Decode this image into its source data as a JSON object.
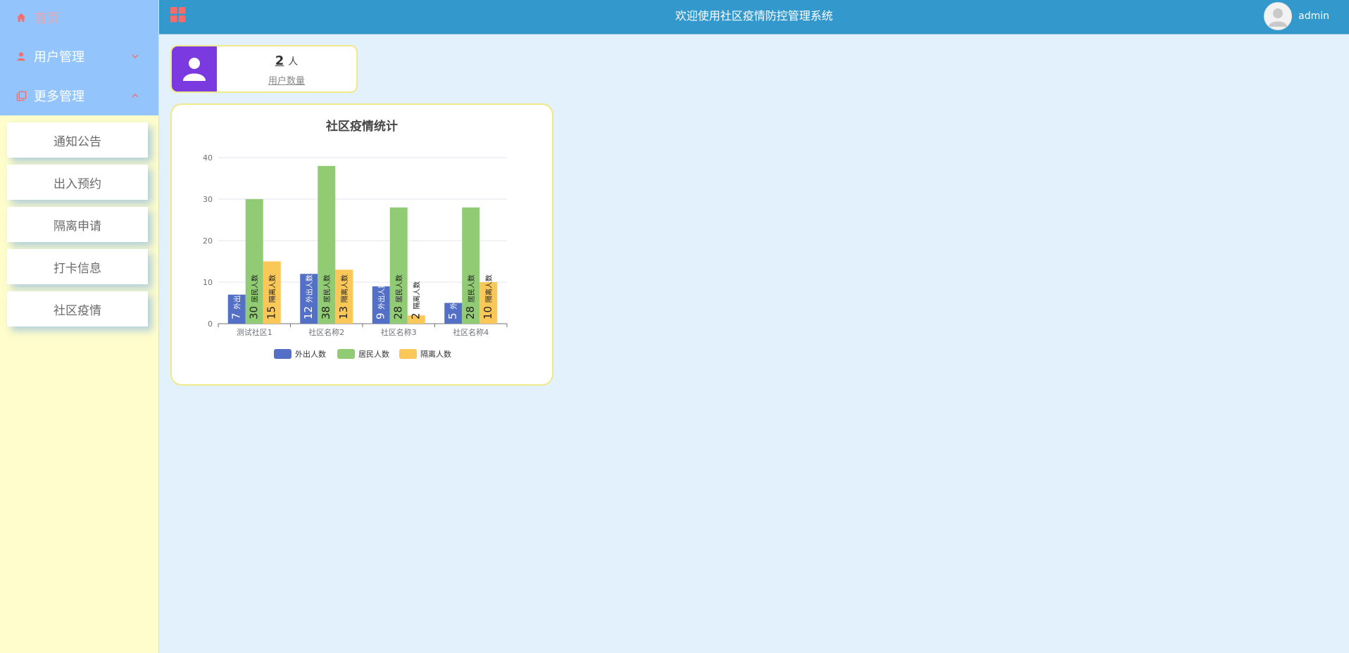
{
  "header": {
    "title": "欢迎使用社区疫情防控管理系统",
    "user": "admin",
    "bg_color": "#3399cc"
  },
  "sidebar": {
    "home": "首页",
    "items": [
      {
        "label": "用户管理",
        "icon": "user-icon",
        "expanded": false
      },
      {
        "label": "更多管理",
        "icon": "copy-icon",
        "expanded": true
      }
    ],
    "submenu": [
      "通知公告",
      "出入预约",
      "隔离申请",
      "打卡信息",
      "社区疫情"
    ]
  },
  "stat": {
    "value": "2",
    "unit": "人",
    "label": "用户数量",
    "icon": "user-icon"
  },
  "chart_data": {
    "type": "bar",
    "title": "社区疫情统计",
    "categories": [
      "测试社区1",
      "社区名称2",
      "社区名称3",
      "社区名称4"
    ],
    "series": [
      {
        "name": "外出人数",
        "values": [
          7,
          12,
          9,
          5
        ],
        "color": "#5470c6"
      },
      {
        "name": "居民人数",
        "values": [
          30,
          38,
          28,
          28
        ],
        "color": "#91cc75"
      },
      {
        "name": "隔离人数",
        "values": [
          15,
          13,
          2,
          10
        ],
        "color": "#fac858"
      }
    ],
    "ylim": [
      0,
      40
    ],
    "yticks": [
      0,
      10,
      20,
      30,
      40
    ],
    "grid": true,
    "legend": "bottom-center"
  }
}
